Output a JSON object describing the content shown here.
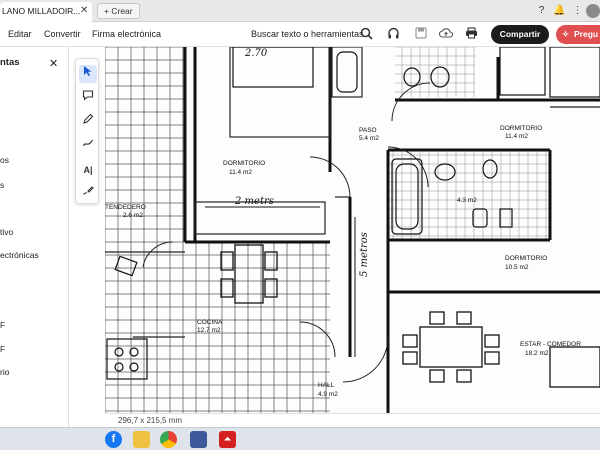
{
  "tabbar": {
    "tab_title": "LANO MILLADOIR...",
    "new_tab_label": "Crear"
  },
  "menu": {
    "items": [
      "Editar",
      "Convertir",
      "Firma electrónica"
    ],
    "search_label": "Buscar texto o herramientas",
    "share_label": "Compartir",
    "ask_label": "Pregu"
  },
  "left_panel": {
    "title": "ntas",
    "items": [
      "os",
      "s",
      "tivo",
      "ectrónicas",
      "F",
      "F",
      "rio"
    ]
  },
  "document": {
    "rooms": [
      {
        "name": "DORMITORIO",
        "area": "11.4 m2"
      },
      {
        "name": "PASO",
        "area": "5.4 m2"
      },
      {
        "name": "DORMITORIO",
        "area": "11.4 m2"
      },
      {
        "name": "TENDEDERO",
        "area": "2.6 m2"
      },
      {
        "name": "DORMITORIO",
        "area": "10.5 m2"
      },
      {
        "name": "COCINA",
        "area": "12.7 m2"
      },
      {
        "name": "ESTAR - COMEDOR",
        "area": "18.2 m2"
      },
      {
        "name": "HALL",
        "area": "4.9 m2"
      }
    ],
    "bath_area": "4.3 m2",
    "dim_top": "2.70",
    "dim_middle": "2 metrs",
    "dim_vertical": "5 metros"
  },
  "status": {
    "page_size": "296,7 x 215,5 mm"
  },
  "colors": {
    "accent": "#1a58d8",
    "share_bg": "#1b1b1b",
    "ask_bg": "#e05050"
  }
}
